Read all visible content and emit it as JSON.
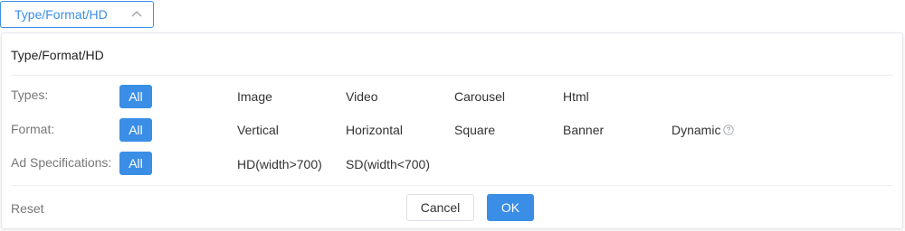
{
  "trigger": {
    "label": "Type/Format/HD"
  },
  "panel": {
    "title": "Type/Format/HD",
    "rows": [
      {
        "label": "Types:",
        "all_label": "All",
        "options": [
          "Image",
          "Video",
          "Carousel",
          "Html"
        ]
      },
      {
        "label": "Format:",
        "all_label": "All",
        "options": [
          "Vertical",
          "Horizontal",
          "Square",
          "Banner",
          "Dynamic"
        ]
      },
      {
        "label": "Ad Specifications:",
        "all_label": "All",
        "options": [
          "HD(width>700)",
          "SD(width<700)"
        ]
      }
    ]
  },
  "footer": {
    "reset_label": "Reset",
    "cancel_label": "Cancel",
    "ok_label": "OK"
  },
  "colors": {
    "accent": "#3a8ee6",
    "border": "#e4e7ed",
    "muted_text": "#777777"
  },
  "icons": {
    "trigger_chevron": "chevron-up-icon",
    "dynamic_help": "question-circle-icon"
  }
}
